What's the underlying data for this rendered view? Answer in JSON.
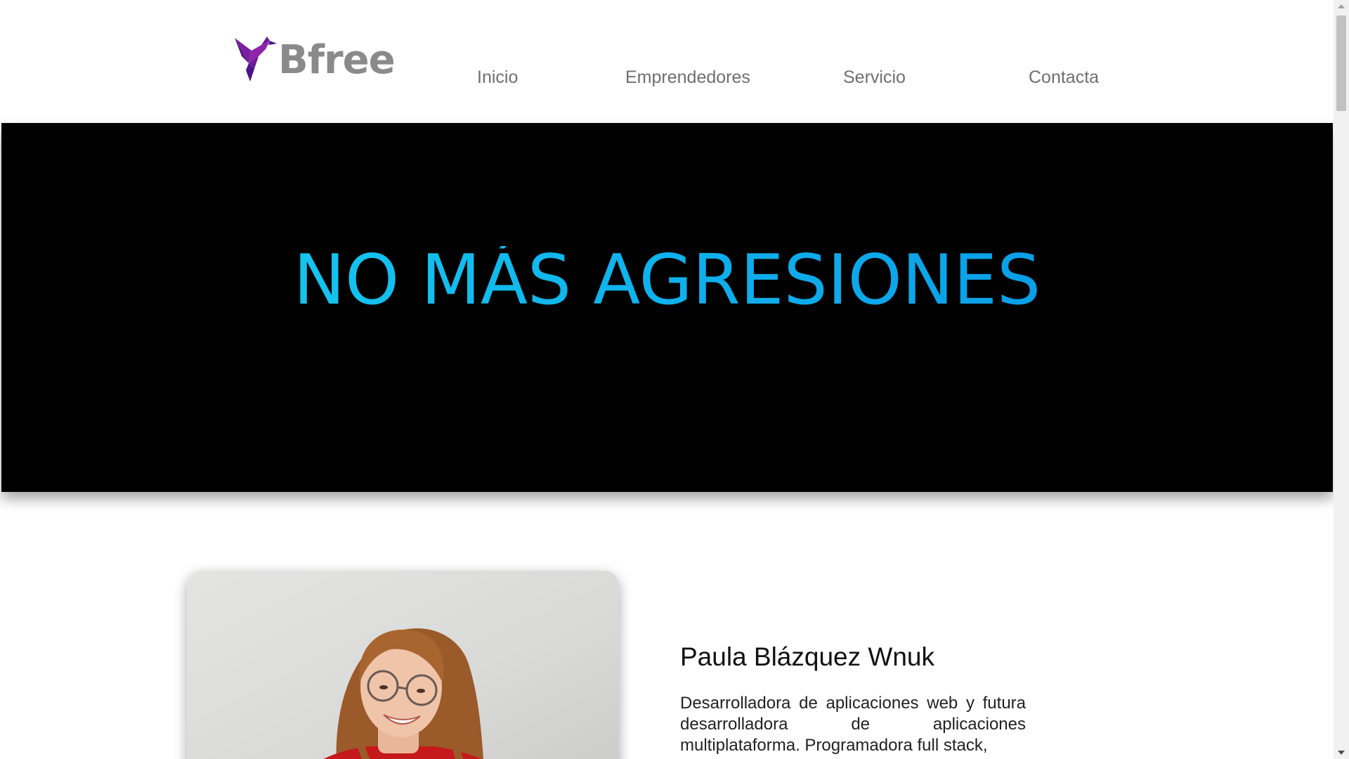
{
  "header": {
    "logo": {
      "text": "Bfree",
      "icon": "hummingbird-logo-icon",
      "icon_color": "#6a1b9a",
      "text_color": "#8a8a8a"
    },
    "nav": [
      {
        "label": "Inicio"
      },
      {
        "label": "Emprendedores"
      },
      {
        "label": "Servicio"
      },
      {
        "label": "Contacta"
      }
    ]
  },
  "hero": {
    "title": "NO MÁS AGRESIONES",
    "background_color": "#000000",
    "title_color": "#12b4ec"
  },
  "profile": {
    "name": "Paula Blázquez Wnuk",
    "description": "Desarrolladora de aplicaciones web y futura desarrolladora de aplicaciones multiplataforma. Programadora full stack,"
  },
  "scrollbar": {
    "position": 0
  }
}
